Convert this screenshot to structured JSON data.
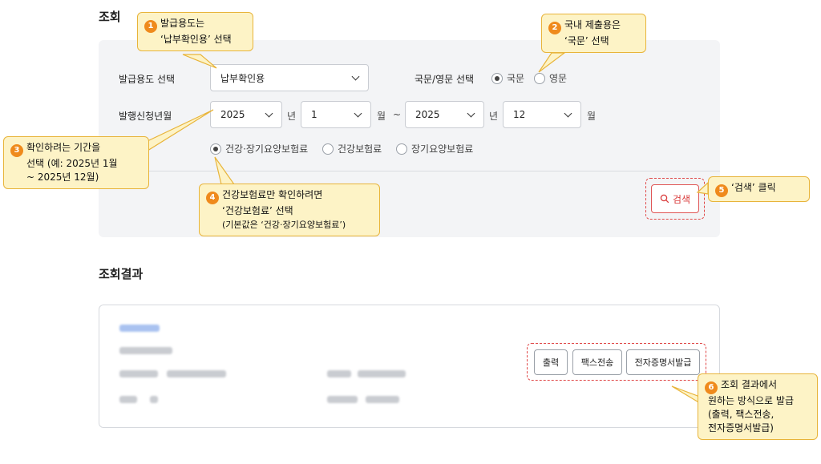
{
  "inquiry": {
    "title": "조회",
    "purpose_label": "발급용도 선택",
    "purpose_value": "납부확인용",
    "language_label": "국문/영문 선택",
    "language_options": [
      "국문",
      "영문"
    ],
    "period_label": "발행신청년월",
    "start_year": "2025",
    "start_month": "1",
    "end_year": "2025",
    "end_month": "12",
    "year_unit": "년",
    "month_unit": "월",
    "tilde": "~",
    "insurance_options": [
      "건강·장기요양보험료",
      "건강보험료",
      "장기요양보험료"
    ],
    "search_label": "검색"
  },
  "results": {
    "title": "조회결과",
    "buttons": [
      "출력",
      "팩스전송",
      "전자증명서발급"
    ]
  },
  "callouts": {
    "c1": {
      "num": "1",
      "line1": "발급용도는",
      "line2": "‘납부확인용’ 선택"
    },
    "c2": {
      "num": "2",
      "line1": "국내 제출용은",
      "line2": "‘국문’ 선택"
    },
    "c3": {
      "num": "3",
      "line1": "확인하려는 기간을",
      "line2": "선택 (예: 2025년 1월",
      "line3": "~ 2025년 12월)"
    },
    "c4": {
      "num": "4",
      "line1": "건강보험료만 확인하려면",
      "line2": "‘건강보험료’ 선택",
      "line3": "(기본값은 ‘건강·장기요양보험료’)"
    },
    "c5": {
      "num": "5",
      "line1": "‘검색’ 클릭"
    },
    "c6": {
      "num": "6",
      "line1": "조회 결과에서",
      "line2": "원하는 방식으로 발급",
      "line3": "(출력, 팩스전송,",
      "line4": "전자증명서발급)"
    }
  },
  "colors": {
    "accent_red": "#e04848",
    "callout_bg": "#fdf3c6",
    "callout_border": "#e8b43a",
    "badge": "#ef8a1c"
  }
}
